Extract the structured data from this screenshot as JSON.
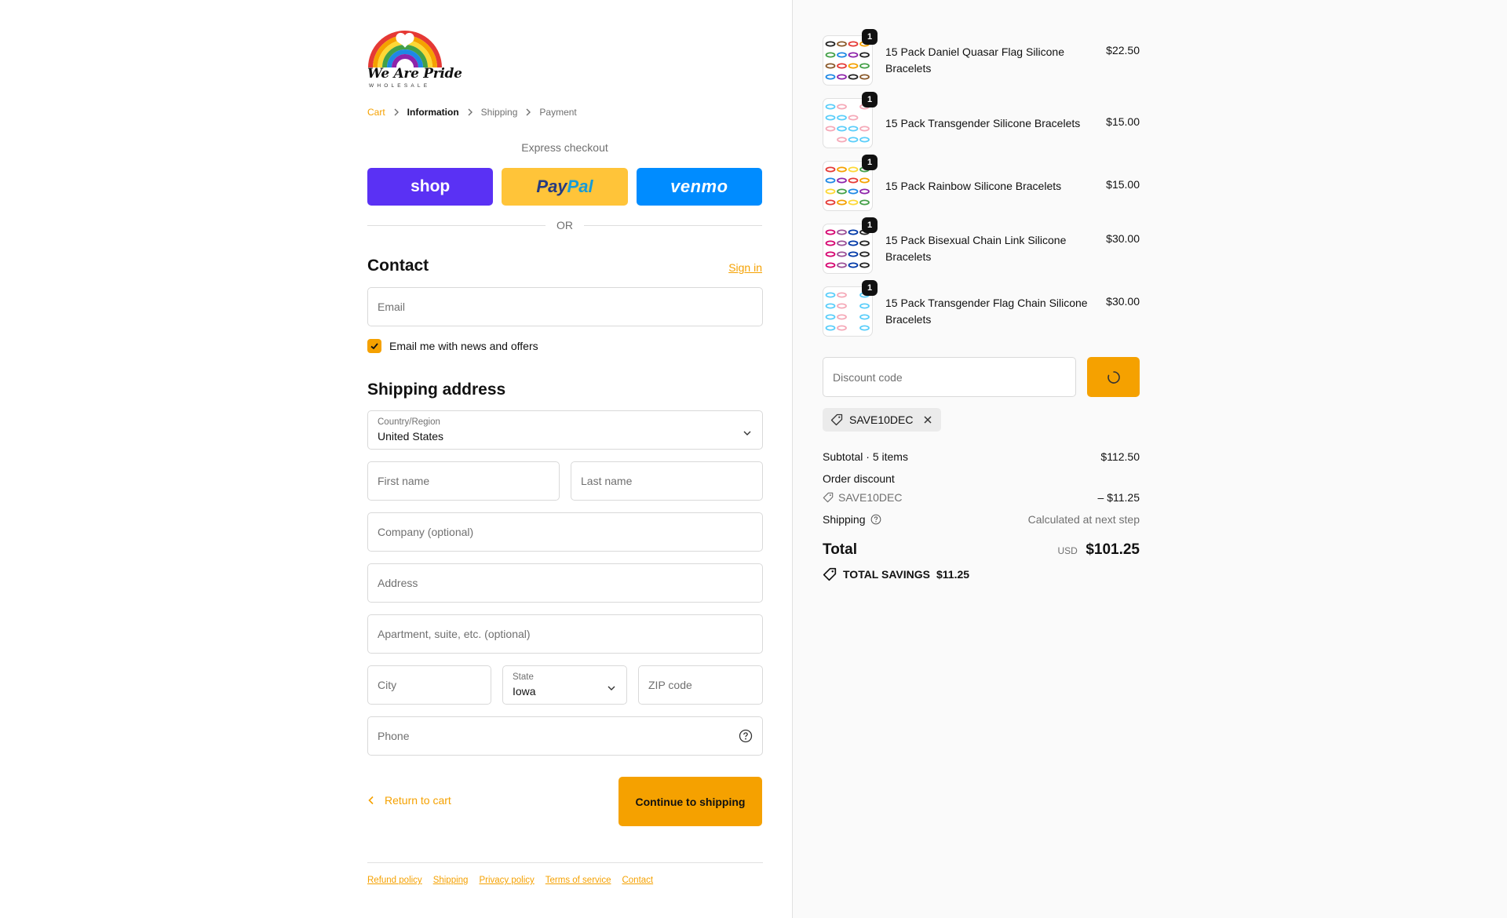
{
  "brand": {
    "name": "We Are Pride",
    "tagline": "WHOLESALE",
    "accent_color": "#f5a100"
  },
  "breadcrumb": [
    {
      "label": "Cart",
      "state": "link"
    },
    {
      "label": "Information",
      "state": "current"
    },
    {
      "label": "Shipping",
      "state": "upcoming"
    },
    {
      "label": "Payment",
      "state": "upcoming"
    }
  ],
  "express": {
    "label": "Express checkout",
    "buttons": [
      {
        "name": "shop",
        "label": "shop",
        "color": "#5a31f4"
      },
      {
        "name": "paypal",
        "label_part1": "Pay",
        "label_part2": "Pal",
        "color": "#ffc439"
      },
      {
        "name": "venmo",
        "label": "venmo",
        "color": "#008cff"
      }
    ],
    "or_label": "OR"
  },
  "contact": {
    "title": "Contact",
    "sign_in_label": "Sign in",
    "email_placeholder": "Email",
    "email_value": "",
    "newsletter_label": "Email me with news and offers",
    "newsletter_checked": true
  },
  "shipping": {
    "title": "Shipping address",
    "country_label": "Country/Region",
    "country_value": "United States",
    "first_name_placeholder": "First name",
    "last_name_placeholder": "Last name",
    "company_placeholder": "Company (optional)",
    "address_placeholder": "Address",
    "apartment_placeholder": "Apartment, suite, etc. (optional)",
    "city_placeholder": "City",
    "state_label": "State",
    "state_value": "Iowa",
    "zip_placeholder": "ZIP code",
    "phone_placeholder": "Phone"
  },
  "actions": {
    "return_label": "Return to cart",
    "continue_label": "Continue to shipping"
  },
  "footer": {
    "links": [
      "Refund policy",
      "Shipping",
      "Privacy policy",
      "Terms of service",
      "Contact"
    ]
  },
  "cart": {
    "items": [
      {
        "name": "15 Pack Daniel Quasar Flag Silicone Bracelets",
        "price": "$22.50",
        "qty": "1",
        "icon": "bracelets-thumbnail",
        "colors": [
          "#222",
          "#8b5a2b",
          "#e53935",
          "#f5a100",
          "#43a047",
          "#1e88e5",
          "#8e24aa"
        ]
      },
      {
        "name": "15 Pack Transgender Silicone Bracelets",
        "price": "$15.00",
        "qty": "1",
        "icon": "bracelets-thumbnail",
        "colors": [
          "#5bcefa",
          "#f5a9b8",
          "#ffffff",
          "#f5a9b8",
          "#5bcefa"
        ]
      },
      {
        "name": "15 Pack Rainbow Silicone Bracelets",
        "price": "$15.00",
        "qty": "1",
        "icon": "bracelets-thumbnail",
        "colors": [
          "#e53935",
          "#f5a100",
          "#fdd835",
          "#43a047",
          "#1e88e5",
          "#8e24aa"
        ]
      },
      {
        "name": "15 Pack Bisexual Chain Link Silicone Bracelets",
        "price": "$30.00",
        "qty": "1",
        "icon": "bracelets-thumbnail",
        "colors": [
          "#d60270",
          "#9b4f96",
          "#0038a8",
          "#222"
        ]
      },
      {
        "name": "15 Pack Transgender Flag Chain Silicone Bracelets",
        "price": "$30.00",
        "qty": "1",
        "icon": "bracelets-thumbnail",
        "colors": [
          "#5bcefa",
          "#f5a9b8",
          "#ffffff",
          "#5bcefa"
        ]
      }
    ],
    "discount_placeholder": "Discount code",
    "applied_code": "SAVE10DEC",
    "subtotal_label": "Subtotal · 5 items",
    "subtotal_value": "$112.50",
    "order_discount_label": "Order discount",
    "discount_code_label": "SAVE10DEC",
    "discount_value": "– $11.25",
    "shipping_label": "Shipping",
    "shipping_value": "Calculated at next step",
    "total_label": "Total",
    "total_currency": "USD",
    "total_value": "$101.25",
    "savings_label": "TOTAL SAVINGS",
    "savings_value": "$11.25"
  }
}
